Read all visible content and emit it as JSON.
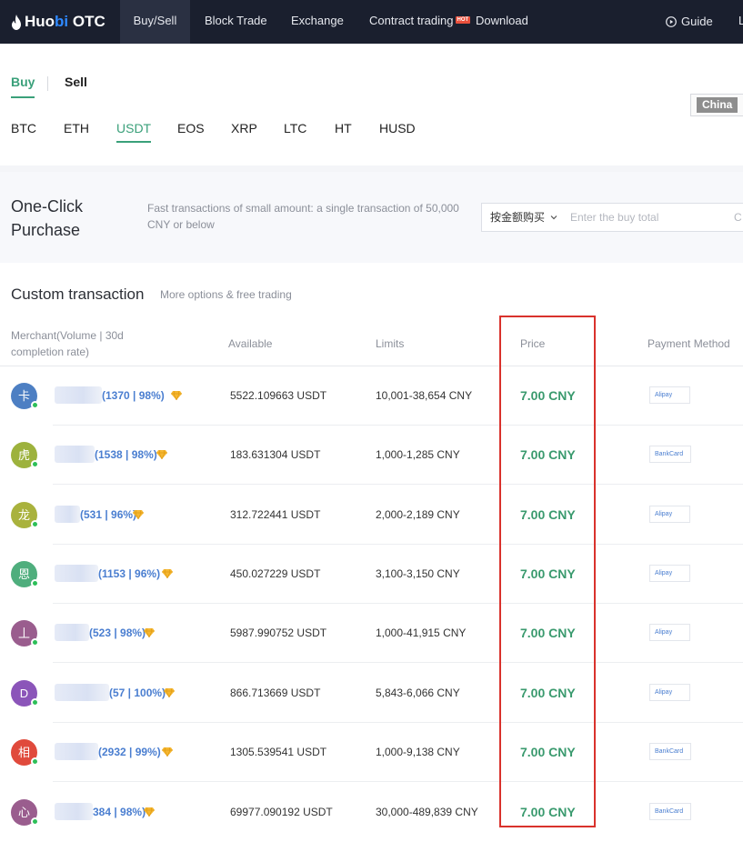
{
  "nav": {
    "logo": {
      "huo": "Huo",
      "bi": "bi",
      "otc": " OTC"
    },
    "items": [
      {
        "label": "Buy/Sell",
        "active": true
      },
      {
        "label": "Block Trade"
      },
      {
        "label": "Exchange"
      },
      {
        "label": "Contract trading",
        "badge": "HOT"
      },
      {
        "label": "Download"
      }
    ],
    "guide": "Guide",
    "cutoff": "L"
  },
  "trade_tabs": {
    "buy": "Buy",
    "sell": "Sell",
    "active": "Buy"
  },
  "coins": [
    "BTC",
    "ETH",
    "USDT",
    "EOS",
    "XRP",
    "LTC",
    "HT",
    "HUSD"
  ],
  "active_coin": "USDT",
  "region": "China",
  "one_click": {
    "title": "One-Click Purchase",
    "description": "Fast transactions of small amount: a single transaction of 50,000 CNY or below",
    "select_value": "按金额购买",
    "input_placeholder": "Enter the buy total",
    "input_suffix": "C"
  },
  "custom": {
    "title": "Custom transaction",
    "subtitle": "More options & free trading",
    "headers": {
      "merchant": "Merchant(Volume | 30d completion rate)",
      "available": "Available",
      "limits": "Limits",
      "price": "Price",
      "payment": "Payment Method"
    },
    "rows": [
      {
        "initial": "卡",
        "color": "#4d7fc3",
        "merchant": "(1370 | 98%)",
        "available": "5522.109663 USDT",
        "limits": "10,001-38,654 CNY",
        "price": "7.00 CNY",
        "payment": "Alipay"
      },
      {
        "initial": "虎",
        "color": "#9db23d",
        "merchant": "(1538 | 98%)",
        "available": "183.631304 USDT",
        "limits": "1,000-1,285 CNY",
        "price": "7.00 CNY",
        "payment": "BankCard"
      },
      {
        "initial": "龙",
        "color": "#a9b23d",
        "merchant": "(531 | 96%)",
        "available": "312.722441 USDT",
        "limits": "2,000-2,189 CNY",
        "price": "7.00 CNY",
        "payment": "Alipay"
      },
      {
        "initial": "恩",
        "color": "#4fae7d",
        "merchant": "(1153 | 96%)",
        "available": "450.027229 USDT",
        "limits": "3,100-3,150 CNY",
        "price": "7.00 CNY",
        "payment": "Alipay"
      },
      {
        "initial": "丄",
        "color": "#9a5d8e",
        "merchant": "(523 | 98%)",
        "available": "5987.990752 USDT",
        "limits": "1,000-41,915 CNY",
        "price": "7.00 CNY",
        "payment": "Alipay"
      },
      {
        "initial": "D",
        "color": "#8b55b9",
        "merchant": "(57 | 100%)",
        "available": "866.713669 USDT",
        "limits": "5,843-6,066 CNY",
        "price": "7.00 CNY",
        "payment": "Alipay"
      },
      {
        "initial": "相",
        "color": "#e04a3c",
        "merchant": "(2932 | 99%)",
        "available": "1305.539541 USDT",
        "limits": "1,000-9,138 CNY",
        "price": "7.00 CNY",
        "payment": "BankCard"
      },
      {
        "initial": "心",
        "color": "#9a5d8e",
        "merchant": "384 | 98%)",
        "available": "69977.090192 USDT",
        "limits": "30,000-489,839 CNY",
        "price": "7.00 CNY",
        "payment": "BankCard"
      }
    ]
  },
  "colors": {
    "brand_green": "#3aa07a",
    "price_green": "#3a9a6e",
    "nav_bg": "#1a1f2e",
    "highlight_red": "#d9322c",
    "merchant_blue": "#4a7ed0"
  }
}
